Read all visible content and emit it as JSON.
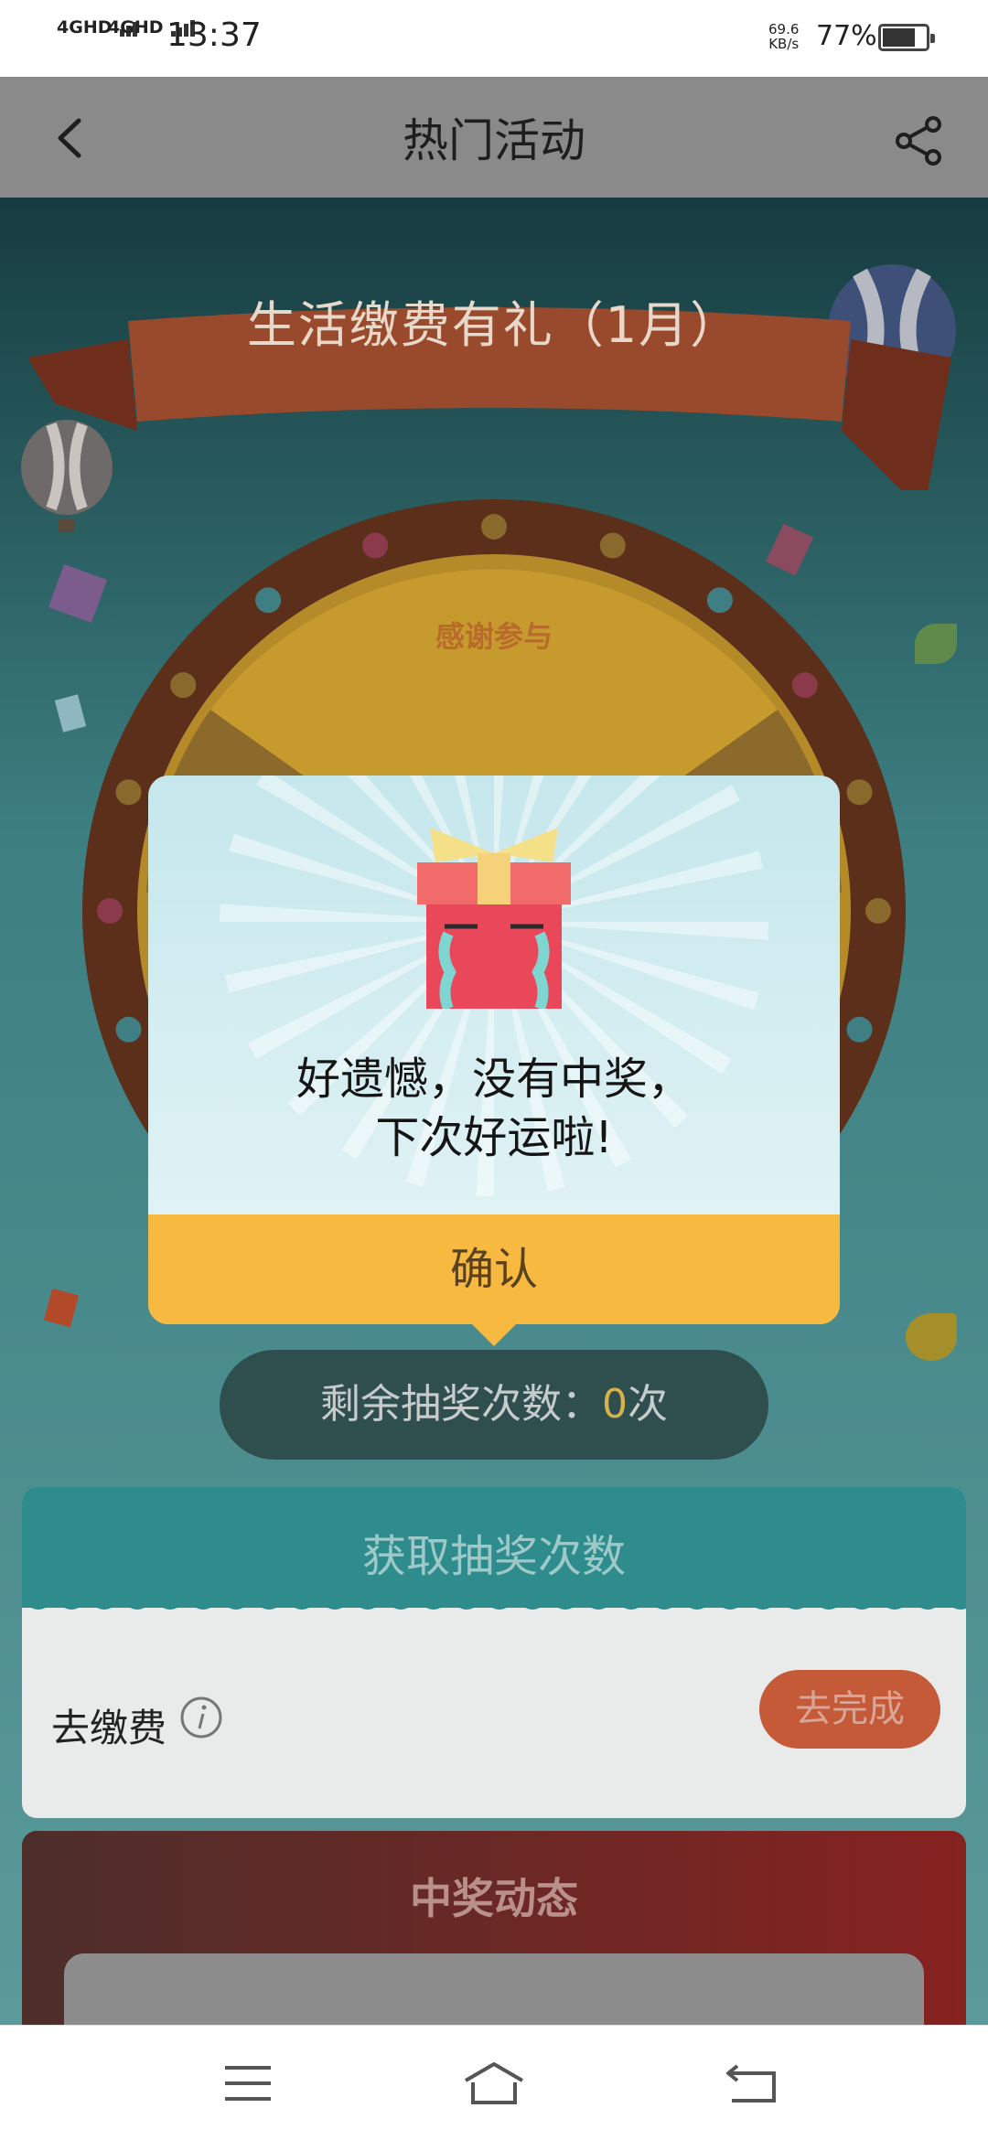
{
  "status_bar": {
    "sim1": "4GHD",
    "sim2": "4GHD",
    "time": "13:37",
    "speed_value": "69.6",
    "speed_unit": "KB/s",
    "battery": "77%",
    "battery_level": 0.77
  },
  "header": {
    "title": "热门活动",
    "back_icon": "chevron-left-icon",
    "share_icon": "share-icon"
  },
  "background": {
    "banner_title": "生活缴费有礼（1月）",
    "wheel_segment": "感谢参与",
    "remaining_label": "剩余抽奖次数：",
    "remaining_count": "0",
    "remaining_unit": "次",
    "task_section_title": "获取抽奖次数",
    "task_label": "去缴费",
    "task_button": "去完成",
    "news_title": "中奖动态"
  },
  "dialog": {
    "icon": "crying-gift-icon",
    "line1": "好遗憾，没有中奖，",
    "line2": "下次好运啦!",
    "confirm": "确认"
  },
  "navbar": {
    "menu_icon": "menu-icon",
    "home_icon": "home-icon",
    "back_icon": "back-arrow-icon"
  },
  "colors": {
    "header_dim": "#8a8a8a",
    "dialog_top": "#c5e7ec",
    "confirm_button": "#f8b941",
    "gift_red": "#e8485a",
    "gift_ribbon": "#f5e08a"
  }
}
